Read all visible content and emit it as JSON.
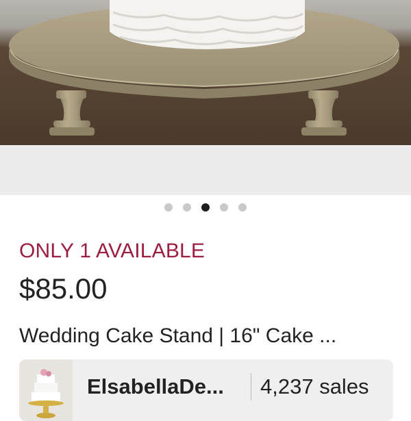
{
  "listing": {
    "image_carousel": {
      "image_alt": "Gold cake stand with white ruffled cake",
      "dot_count": 5,
      "active_index": 2
    },
    "availability": "ONLY 1 AVAILABLE",
    "price": "$85.00",
    "title": "Wedding Cake Stand | 16\" Cake ..."
  },
  "shop": {
    "name": "ElsabellaDe...",
    "sales": "4,237 sales"
  },
  "colors": {
    "availability_text": "#9b1d3f",
    "active_dot": "#1f1f1f",
    "inactive_dot": "#c9c9c9",
    "stand_gold": "#a89a7c"
  }
}
